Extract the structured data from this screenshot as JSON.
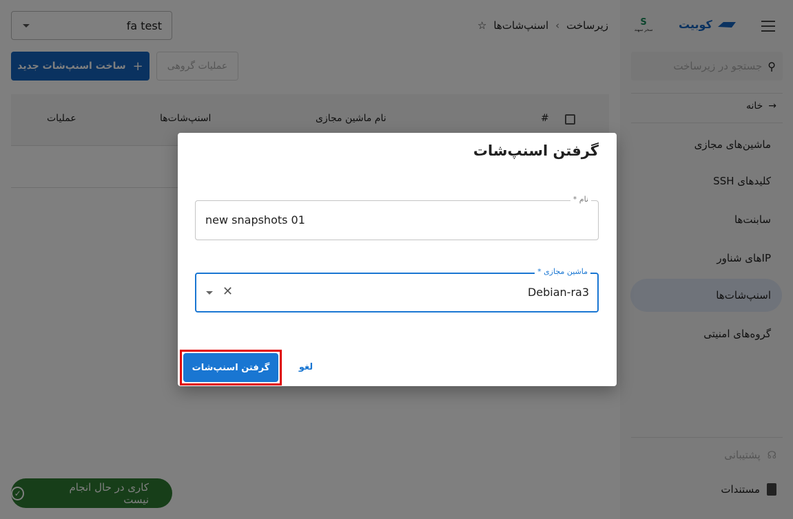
{
  "sidebar": {
    "brand": "کوبیت",
    "partner_logo_text": "سحر سهند",
    "search_placeholder": "جستجو در زیرساخت",
    "home": "خانه",
    "items": [
      {
        "label": "ماشین‌های مجازی"
      },
      {
        "label": "کلیدهای SSH"
      },
      {
        "label": "سابنت‌ها"
      },
      {
        "label": "IPهای شناور"
      },
      {
        "label": "اسنپ‌شات‌ها",
        "active": true
      },
      {
        "label": "گروه‌های امنیتی"
      }
    ],
    "support": "پشتیبانی",
    "docs": "مستندات"
  },
  "header": {
    "breadcrumb": [
      "زیرساخت",
      "اسنپ‌شات‌ها"
    ],
    "project_select": "fa test"
  },
  "toolbar": {
    "new_snapshot": "ساخت اسنپ‌شات جدید",
    "bulk_actions": "عملیات گروهی"
  },
  "table": {
    "columns": [
      "#",
      "نام ماشین مجازی",
      "اسنپ‌شات‌ها",
      "عملیات"
    ]
  },
  "dialog": {
    "title": "گرفتن اسنپ‌شات",
    "name_label": "نام *",
    "name_value": "new snapshots 01",
    "vm_label": "ماشین مجازی *",
    "vm_value": "Debian-ra3",
    "submit": "گرفتن اسنپ‌شات",
    "cancel": "لغو"
  },
  "toast": {
    "text": "کاری در حال انجام نیست"
  },
  "colors": {
    "primary": "#1976d2",
    "brand": "#1565c0",
    "highlight": "#e00000",
    "toast": "#2e7d32"
  }
}
